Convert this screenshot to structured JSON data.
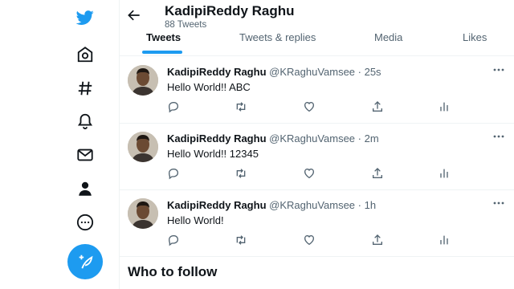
{
  "nav": {
    "icons": [
      "twitter-logo",
      "home-icon",
      "explore-hashtag-icon",
      "notifications-bell-icon",
      "messages-mail-icon",
      "profile-person-icon",
      "more-circle-icon"
    ],
    "compose_icon": "feather-plus-icon",
    "accent": "#1d9bf0"
  },
  "header": {
    "name": "KadipiReddy Raghu",
    "tweet_count": "88 Tweets"
  },
  "tabs": [
    {
      "label": "Tweets",
      "active": true
    },
    {
      "label": "Tweets & replies",
      "active": false
    },
    {
      "label": "Media",
      "active": false
    },
    {
      "label": "Likes",
      "active": false
    }
  ],
  "tweets": [
    {
      "author": "KadipiReddy Raghu",
      "meta": "@KRaghuVamsee · 25s",
      "text": "Hello World!! ABC"
    },
    {
      "author": "KadipiReddy Raghu",
      "meta": "@KRaghuVamsee · 2m",
      "text": "Hello World!! 12345"
    },
    {
      "author": "KadipiReddy Raghu",
      "meta": "@KRaghuVamsee · 1h",
      "text": "Hello World!"
    }
  ],
  "tweet_actions": [
    "reply-icon",
    "retweet-icon",
    "like-heart-icon",
    "share-icon",
    "analytics-icon"
  ],
  "who_to_follow": "Who to follow"
}
